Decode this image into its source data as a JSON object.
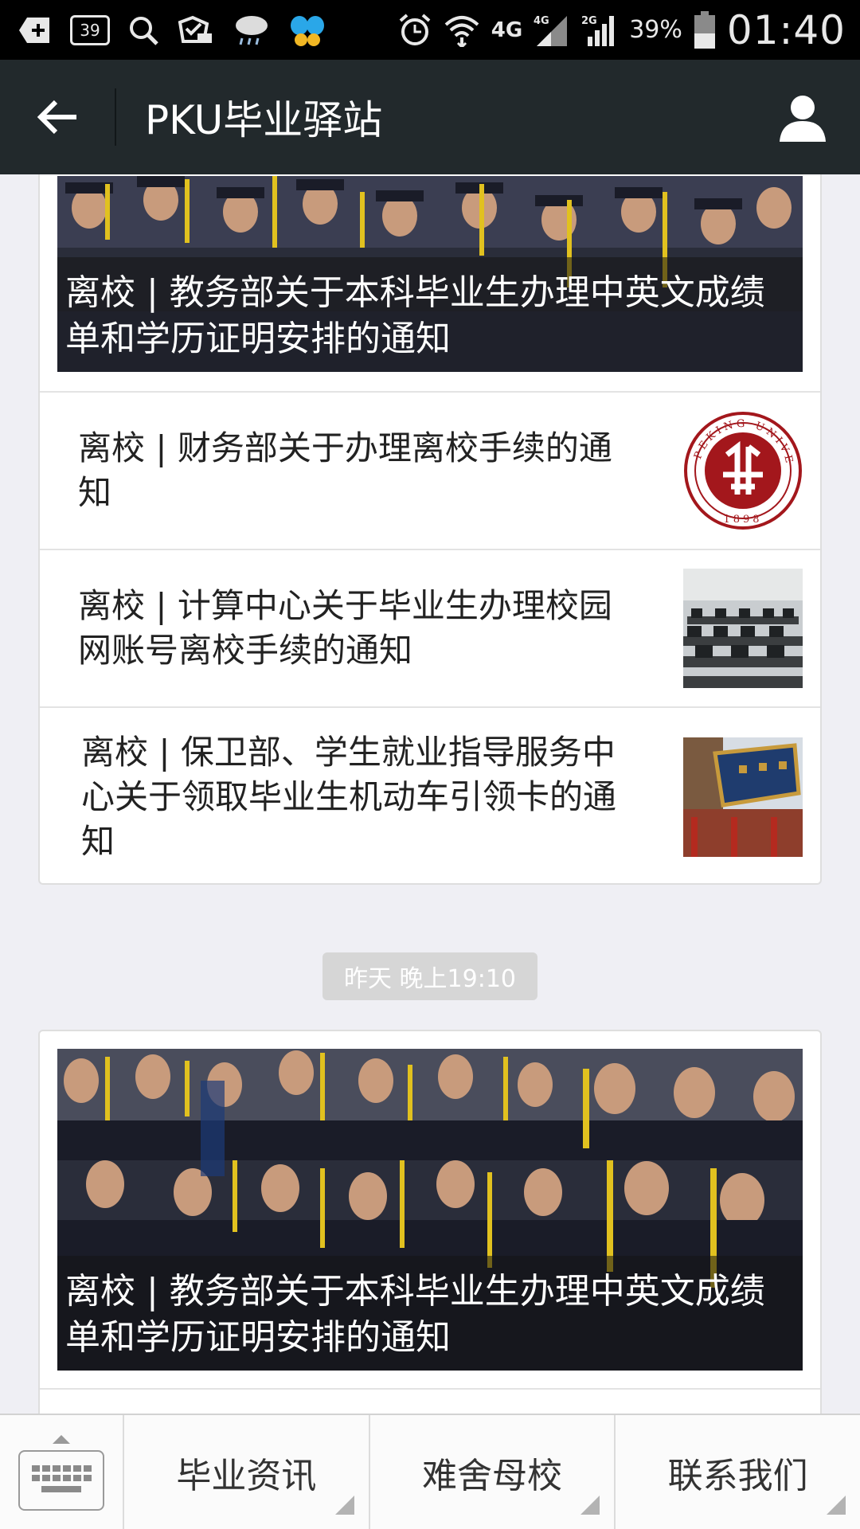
{
  "status_bar": {
    "notification_count": "39",
    "network_primary": "4G",
    "network_secondary_1": "4G",
    "network_secondary_2": "2G",
    "battery_percent": "39%",
    "time": "01:40"
  },
  "header": {
    "title": "PKU毕业驿站"
  },
  "feed": {
    "card_1": {
      "cover_title": "离校 | 教务部关于本科毕业生办理中英文成绩单和学历证明安排的通知",
      "items": [
        {
          "title": "离校 | 财务部关于办理离校手续的通知",
          "thumb": "peking-university-seal"
        },
        {
          "title": "离校 | 计算中心关于毕业生办理校园网账号离校手续的通知",
          "thumb": "computer-lab-photo"
        },
        {
          "title": "离校 | 保卫部、学生就业指导服务中心关于领取毕业生机动车引领卡的通知",
          "thumb": "campus-gate-photo"
        }
      ]
    },
    "timestamp": "昨天 晚上19:10",
    "card_2": {
      "cover_title": "离校 | 教务部关于本科毕业生办理中英文成绩单和学历证明安排的通知"
    }
  },
  "bottom_menu": {
    "items": [
      {
        "label": "毕业资讯"
      },
      {
        "label": "难舍母校"
      },
      {
        "label": "联系我们"
      }
    ]
  },
  "colors": {
    "status_bar": "#000000",
    "title_bar": "#22292c",
    "background": "#efeff4",
    "seal_red": "#a3171c"
  }
}
